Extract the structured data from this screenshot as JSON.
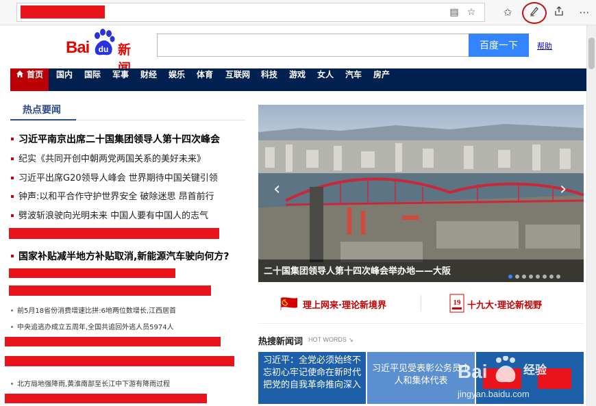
{
  "browser": {
    "icons": [
      "book-icon",
      "star-icon",
      "favorites-icon",
      "pen-icon",
      "share-icon",
      "more-icon"
    ]
  },
  "header": {
    "logo_text": "Bai",
    "logo_du": "du",
    "logo_news": "新闻",
    "search_button": "百度一下",
    "help_link": "帮助"
  },
  "nav": {
    "items": [
      "首页",
      "国内",
      "国际",
      "军事",
      "财经",
      "娱乐",
      "体育",
      "互联网",
      "科技",
      "游戏",
      "女人",
      "汽车",
      "房产"
    ]
  },
  "hot_news": {
    "title": "热点要闻",
    "headlines": [
      "习近平南京出席二十国集团领导人第十四次峰会",
      "纪实《共同开创中朝两党两国关系的美好未来》",
      "习近平出席G20领导人峰会 世界期待中国关键引领",
      "钟声:以和平合作守护世界安全 破除迷思 昂首前行",
      "劈波斩浪驶向光明未来 中国人要有中国人的志气"
    ],
    "headline2": "国家补贴减半地方补贴取消,新能源汽车驶向何方?",
    "small_items": [
      "前5月18省份消费增速比拼:6地两位数增长,江西居首",
      "中央追逃办成立五周年,全国共追回外逃人员5974人",
      "北方局地强降雨,黄淮南部至长江中下游有降雨过程"
    ]
  },
  "slideshow": {
    "caption": "二十国集团领导人第十四次峰会举办地——大阪",
    "prev": "‹",
    "next": "›"
  },
  "banners": {
    "left": "理上网来·理论新境界",
    "right": "十九大·理论新视野"
  },
  "hot_words": {
    "title": "热搜新闻词",
    "subtitle": "HOT WORDS",
    "box1": "习近平：全党必须始终不忘初心牢记使命在新时代把党的自我革命推向深入",
    "box2": "习近平见受表彰公务员个人和集体代表"
  },
  "watermark": {
    "text": "jingyan.baidu.com",
    "jy": "经验"
  },
  "colors": {
    "nav_bg": "#01204f",
    "nav_active": "#bc0006",
    "search_btn": "#3385ff",
    "accent_red": "#c40000",
    "hot_box_dark": "#1d5fa8",
    "hot_box_light": "#5b8fd0"
  }
}
